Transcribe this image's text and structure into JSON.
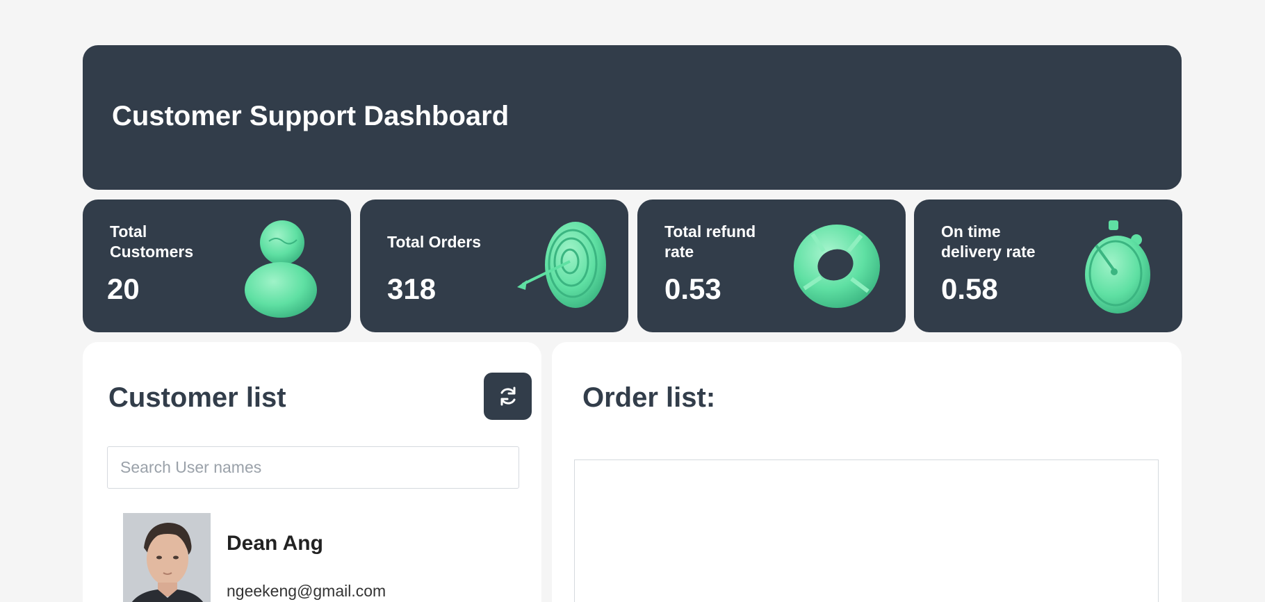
{
  "header": {
    "title": "Customer Support Dashboard"
  },
  "stats": [
    {
      "label": "Total Customers",
      "value": "20",
      "icon": "user-icon"
    },
    {
      "label": "Total Orders",
      "value": "318",
      "icon": "target-icon"
    },
    {
      "label": "Total refund rate",
      "value": "0.53",
      "icon": "lifebuoy-icon"
    },
    {
      "label": "On time delivery rate",
      "value": "0.58",
      "icon": "stopwatch-icon"
    }
  ],
  "customer_list": {
    "title": "Customer list",
    "refresh_icon": "refresh-icon",
    "search_placeholder": "Search User names",
    "search_value": "",
    "customers": [
      {
        "name": "Dean Ang",
        "email": "ngeekeng@gmail.com"
      }
    ]
  },
  "order_list": {
    "title": "Order list:"
  },
  "colors": {
    "background": "#f5f5f5",
    "card": "#323d4a",
    "accent": "#5fe0a3",
    "panel": "#ffffff"
  }
}
